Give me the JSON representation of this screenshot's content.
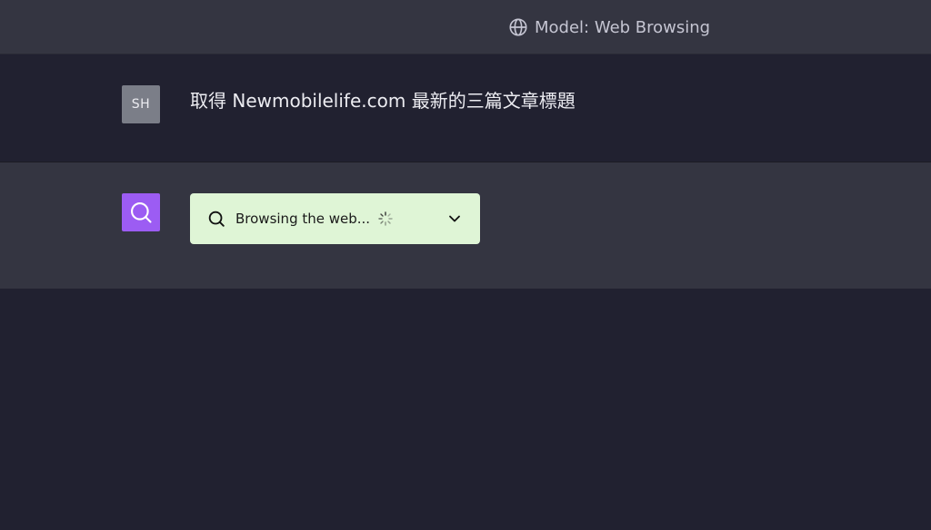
{
  "header": {
    "model_label": "Model: Web Browsing",
    "icon": "globe-icon"
  },
  "conversation": {
    "user": {
      "avatar_initials": "SH",
      "message": "取得 Newmobilelife.com 最新的三篇文章標題"
    },
    "assistant": {
      "avatar_icon": "search-icon",
      "status": "Browsing the web...",
      "status_icon": "search-icon",
      "loading_icon": "spinner-icon",
      "expand_icon": "chevron-down-icon"
    }
  },
  "colors": {
    "background": "#212130",
    "panel": "#343541",
    "assistant_avatar": "#9c5cf3",
    "user_avatar": "#7b7e88",
    "browse_pill": "#dff5d6"
  }
}
